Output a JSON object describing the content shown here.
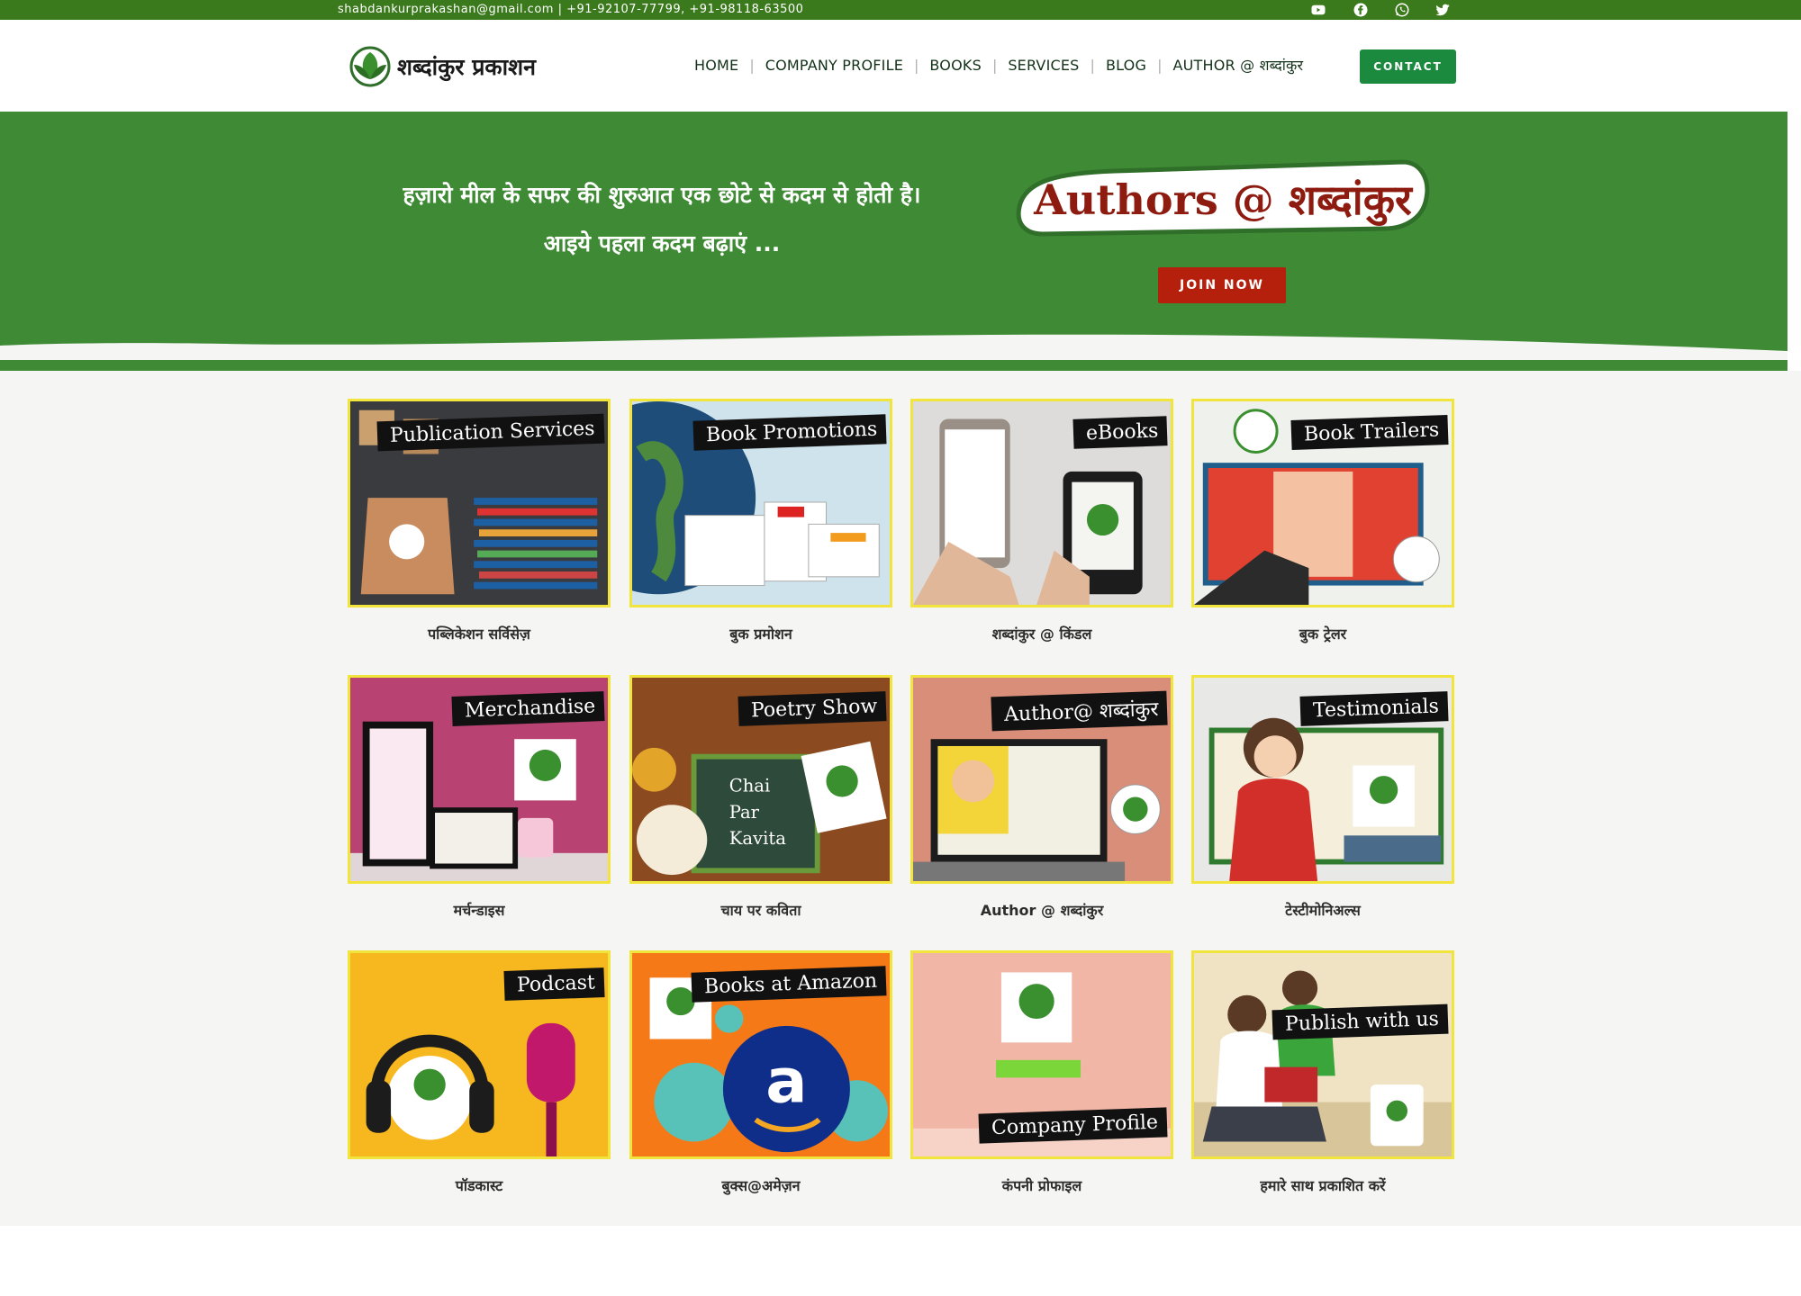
{
  "topbar": {
    "contact_info": "shabdankurprakashan@gmail.com |  +91-92107-77799, +91-98118-63500",
    "social": [
      "youtube-icon",
      "facebook-icon",
      "whatsapp-icon",
      "twitter-icon"
    ]
  },
  "header": {
    "logo_text": "शब्दांकुर प्रकाशन",
    "nav": [
      {
        "label": "HOME"
      },
      {
        "label": "COMPANY PROFILE"
      },
      {
        "label": "BOOKS"
      },
      {
        "label": "SERVICES"
      },
      {
        "label": "BLOG"
      },
      {
        "label": "AUTHOR @ शब्दांकुर"
      }
    ],
    "contact_label": "CONTACT"
  },
  "hero": {
    "line1": "हज़ारो मील के सफर की शुरुआत एक छोटे से कदम से होती है।",
    "line2": "आइये पहला कदम बढ़ाएं ...",
    "authors_logo": "Authors @ शब्दांकुर",
    "join_label": "JOIN NOW"
  },
  "colors": {
    "topbar": "#3b7a1c",
    "hero": "#3f8a34",
    "contact_button": "#1b8a3f",
    "join_button": "#b5200d",
    "card_border": "#f1e43c"
  },
  "cards": [
    {
      "tag": "Publication Services",
      "label": "पब्लिकेशन सर्विसेज़"
    },
    {
      "tag": "Book Promotions",
      "label": "बुक प्रमोशन"
    },
    {
      "tag": "eBooks",
      "label": "शब्दांकुर @ किंडल"
    },
    {
      "tag": "Book Trailers",
      "label": "बुक ट्रेलर"
    },
    {
      "tag": "Merchandise",
      "label": "मर्चन्डाइस"
    },
    {
      "tag": "Poetry Show",
      "label": "चाय पर कविता"
    },
    {
      "tag": "Author@ शब्दांकुर",
      "label": "Author @ शब्दांकुर"
    },
    {
      "tag": "Testimonials",
      "label": "टेस्टीमोनिअल्स"
    },
    {
      "tag": "Podcast",
      "label": "पॉडकास्ट"
    },
    {
      "tag": "Books at Amazon",
      "label": "बुक्स@अमेज़न"
    },
    {
      "tag": "Company Profile",
      "label": "कंपनी प्रोफाइल"
    },
    {
      "tag": "Publish with us",
      "label": "हमारे साथ प्रकाशित करें"
    }
  ]
}
